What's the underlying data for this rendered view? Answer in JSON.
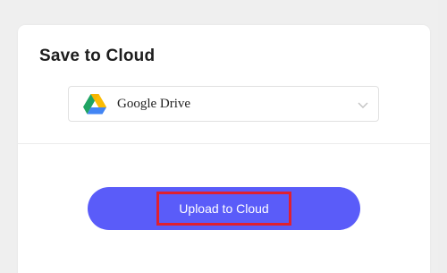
{
  "dialog": {
    "title": "Save to Cloud"
  },
  "cloud_select": {
    "selected_value": "Google Drive",
    "icon": "google-drive-icon",
    "dropdown_icon": "chevron-down-icon"
  },
  "upload": {
    "button_label": "Upload to Cloud",
    "button_color": "#5a5cf9",
    "highlight_color": "#e0202f"
  }
}
